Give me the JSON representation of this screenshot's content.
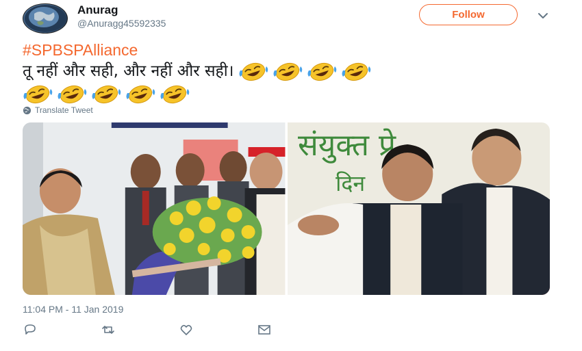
{
  "user": {
    "name": "Anurag",
    "handle": "@Anuragg45592335"
  },
  "follow_label": "Follow",
  "tweet": {
    "hashtag": "#SPBSPAlliance",
    "text": "तू नहीं और सही, और नहीं और सही।",
    "emoji": "face-with-tears-of-joy",
    "emoji_count": 9
  },
  "translate_label": "Translate Tweet",
  "timestamp": "11:04 PM - 11 Jan 2019",
  "colors": {
    "accent": "#f4682f",
    "secondary_text": "#657786",
    "primary_text": "#14171a"
  },
  "actions": {
    "reply_icon": "reply-icon",
    "retweet_icon": "retweet-icon",
    "like_icon": "heart-icon",
    "dm_icon": "envelope-icon"
  }
}
